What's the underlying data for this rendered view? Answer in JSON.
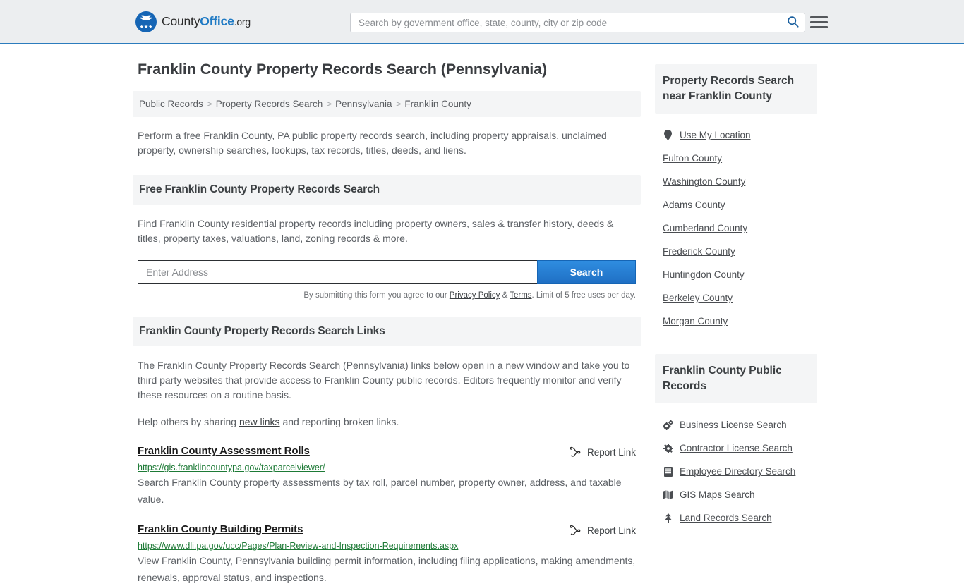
{
  "header": {
    "brand": {
      "part1": "County",
      "part2": "Office",
      "part3": ".org",
      "logo_icon": "eagle-stars-logo",
      "eagle_glyph": "ᴠ",
      "stars_glyph": "★★★"
    },
    "search": {
      "placeholder": "Search by government office, state, county, city or zip code",
      "value": "",
      "search_icon": "magnifier-icon"
    },
    "menu_icon": "hamburger-menu-icon",
    "accent_color": "#2c7cbd"
  },
  "main": {
    "title": "Franklin County Property Records Search (Pennsylvania)",
    "breadcrumb": [
      "Public Records",
      "Property Records Search",
      "Pennsylvania",
      "Franklin County"
    ],
    "breadcrumb_separator": ">",
    "lede": "Perform a free Franklin County, PA public property records search, including property appraisals, unclaimed property, ownership searches, lookups, tax records, titles, deeds, and liens.",
    "free_search": {
      "heading": "Free Franklin County Property Records Search",
      "description": "Find Franklin County residential property records including property owners, sales & transfer history, deeds & titles, property taxes, valuations, land, zoning records & more.",
      "input_placeholder": "Enter Address",
      "input_value": "",
      "submit_label": "Search",
      "note_prefix": "By submitting this form you agree to our ",
      "note_privacy": "Privacy Policy",
      "note_amp": " & ",
      "note_terms": "Terms",
      "note_suffix": ". Limit of 5 free uses per day."
    },
    "links_section": {
      "heading": "Franklin County Property Records Search Links",
      "intro": "The Franklin County Property Records Search (Pennsylvania) links below open in a new window and take you to third party websites that provide access to Franklin County public records. Editors frequently monitor and verify these resources on a routine basis.",
      "help_prefix": "Help others by sharing ",
      "help_link": "new links",
      "help_suffix": " and reporting broken links.",
      "report_label": "Report Link",
      "report_icon": "broken-link-icon",
      "entries": [
        {
          "title": "Franklin County Assessment Rolls",
          "url": "https://gis.franklincountypa.gov/taxparcelviewer/",
          "description": "Search Franklin County property assessments by tax roll, parcel number, property owner, address, and taxable value."
        },
        {
          "title": "Franklin County Building Permits",
          "url": "https://www.dli.pa.gov/ucc/Pages/Plan-Review-and-Inspection-Requirements.aspx",
          "description": "View Franklin County, Pennsylvania building permit information, including filing applications, making amendments, renewals, approval status, and inspections."
        }
      ]
    }
  },
  "sidebar": {
    "nearby": {
      "heading": "Property Records Search near Franklin County",
      "items": [
        {
          "label": "Use My Location",
          "icon": "map-pin-icon"
        },
        {
          "label": "Fulton County",
          "icon": ""
        },
        {
          "label": "Washington County",
          "icon": ""
        },
        {
          "label": "Adams County",
          "icon": ""
        },
        {
          "label": "Cumberland County",
          "icon": ""
        },
        {
          "label": "Frederick County",
          "icon": ""
        },
        {
          "label": "Huntingdon County",
          "icon": ""
        },
        {
          "label": "Berkeley County",
          "icon": ""
        },
        {
          "label": "Morgan County",
          "icon": ""
        }
      ]
    },
    "public_records": {
      "heading": "Franklin County Public Records",
      "items": [
        {
          "label": "Business License Search",
          "icon": "double-gear-icon"
        },
        {
          "label": "Contractor License Search",
          "icon": "gear-icon"
        },
        {
          "label": "Employee Directory Search",
          "icon": "book-icon"
        },
        {
          "label": "GIS Maps Search",
          "icon": "map-icon"
        },
        {
          "label": "Land Records Search",
          "icon": "tree-icon"
        }
      ]
    }
  }
}
